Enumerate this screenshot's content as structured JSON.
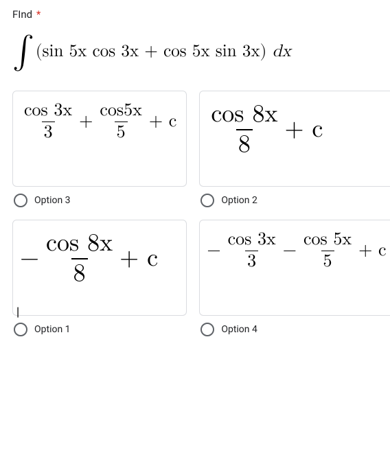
{
  "title": "FInd",
  "required_marker": "*",
  "question": "∫ (sin 5x cos 3x + cos 5x sin 3x) dx",
  "question_parts": {
    "integrand": "(sin 5x cos 3x + cos 5x sin 3x)",
    "dx": "dx"
  },
  "options": [
    {
      "label": "Option 3",
      "frac1_num": "cos 3x",
      "frac1_den": "3",
      "op": "+",
      "frac2_num": "cos5x",
      "frac2_den": "5",
      "tail": "+ c"
    },
    {
      "label": "Option 2",
      "frac_num": "cos 8x",
      "frac_den": "8",
      "tail": "+ c"
    },
    {
      "label": "Option 1",
      "lead": "−",
      "frac_num": "cos 8x",
      "frac_den": "8",
      "tail": "+ c",
      "cursor": "|"
    },
    {
      "label": "Option 4",
      "lead": "−",
      "frac1_num": "cos 3x",
      "frac1_den": "3",
      "op": "−",
      "frac2_num": "cos 5x",
      "frac2_den": "5",
      "tail": "+ c"
    }
  ]
}
